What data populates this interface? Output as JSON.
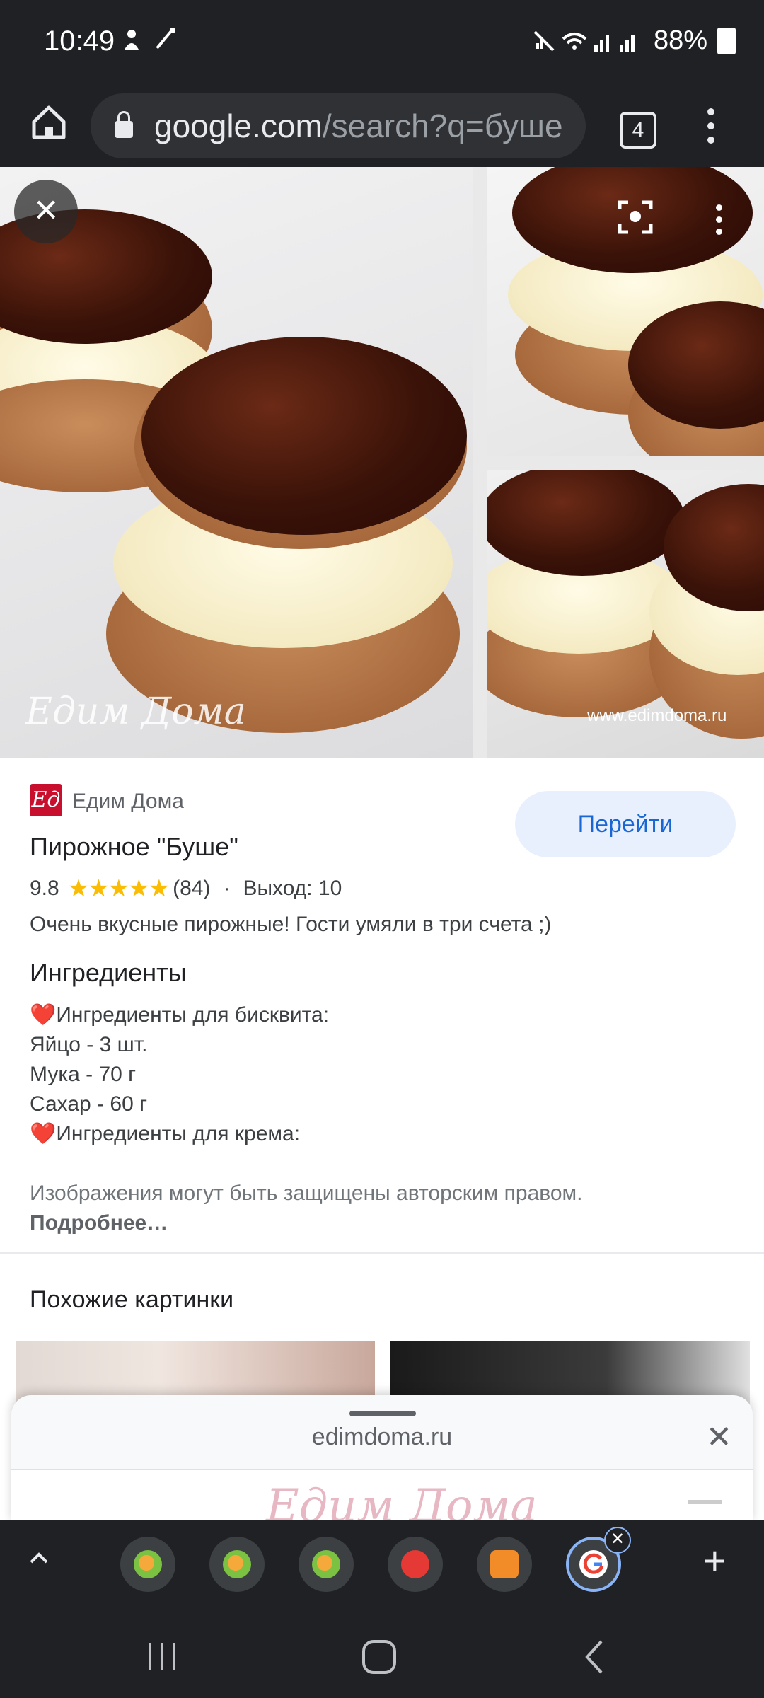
{
  "status_bar": {
    "time": "10:49",
    "battery": "88%"
  },
  "toolbar": {
    "url_host": "google.com",
    "url_rest": "/search?q=буше",
    "tab_count": "4"
  },
  "image_panel": {
    "watermark_main": "Едим Дома",
    "watermark_site": "www.edimdoma.ru"
  },
  "result": {
    "source_name": "Едим Дома",
    "source_logo_text": "Ед",
    "visit_label": "Перейти",
    "title": "Пирожное \"Буше\"",
    "rating": "9.8",
    "stars": "★★★★★",
    "reviews": "(84)",
    "separator": "·",
    "yield": "Выход: 10",
    "description": "Очень вкусные пирожные! Гости умяли в три счета ;)",
    "ingredients_title": "Ингредиенты",
    "ingredients": [
      {
        "heart": "❤️",
        "text": "Ингредиенты для бисквита:"
      },
      {
        "heart": "",
        "text": "Яйцо - 3 шт."
      },
      {
        "heart": "",
        "text": "Мука - 70 г"
      },
      {
        "heart": "",
        "text": "Сахар - 60 г"
      },
      {
        "heart": "❤️",
        "text": "Ингредиенты для крема:"
      }
    ],
    "copyright_text": "Изображения могут быть защищены авторским правом.",
    "copyright_link": "Подробнее…"
  },
  "similar": {
    "title": "Похожие картинки"
  },
  "sheet": {
    "url": "edimdoma.ru",
    "page_logo": "Едим Дома"
  }
}
